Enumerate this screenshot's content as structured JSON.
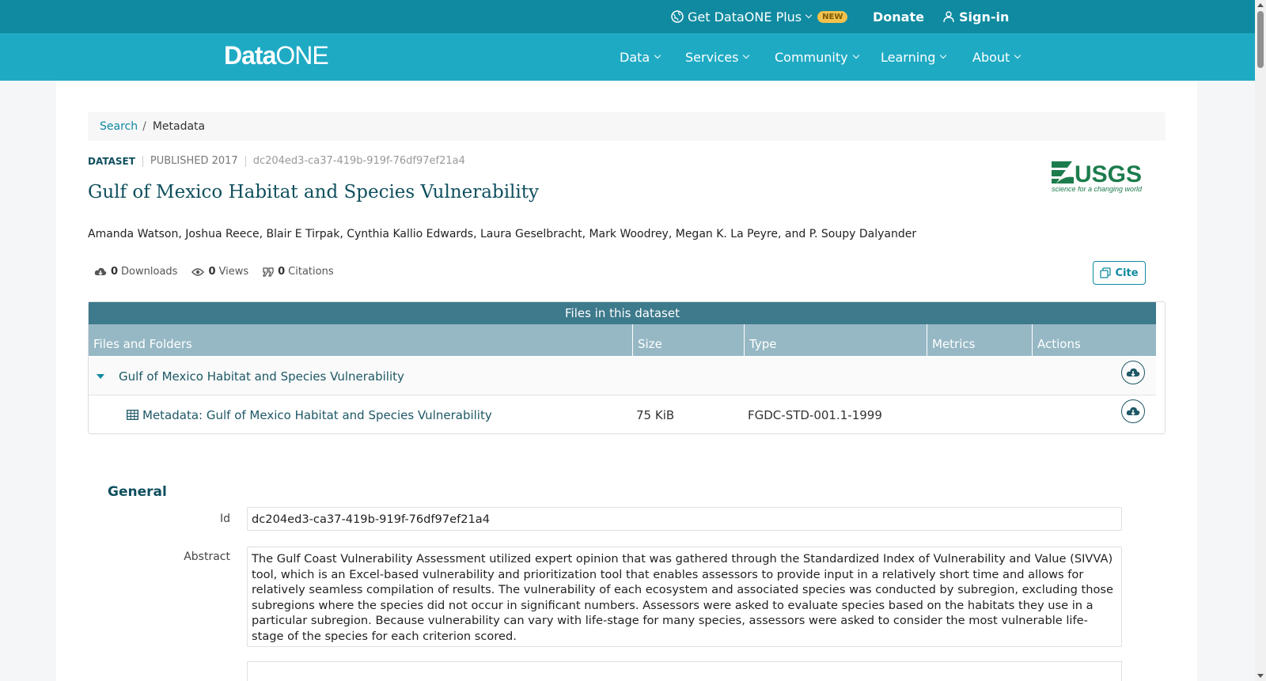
{
  "topbar": {
    "plus_label": "Get DataONE Plus",
    "new_badge": "NEW",
    "donate": "Donate",
    "signin": "Sign-in"
  },
  "nav": {
    "logo_data": "Data",
    "logo_one": "ONE",
    "items": [
      "Data",
      "Services",
      "Community",
      "Learning",
      "About"
    ]
  },
  "breadcrumb": {
    "search": "Search",
    "separator": "/",
    "current": "Metadata"
  },
  "dataset": {
    "type": "DATASET",
    "published": "PUBLISHED 2017",
    "id": "dc204ed3-ca37-419b-919f-76df97ef21a4",
    "title": "Gulf of Mexico Habitat and Species Vulnerability",
    "authors": "Amanda Watson, Joshua Reece, Blair E Tirpak, Cynthia Kallio Edwards, Laura Geselbracht, Mark Woodrey, Megan K. La Peyre, and P. Soupy Dalyander"
  },
  "logo_org": {
    "name": "USGS",
    "tagline": "science for a changing world"
  },
  "stats": {
    "downloads_count": "0",
    "downloads_label": "Downloads",
    "views_count": "0",
    "views_label": "Views",
    "citations_count": "0",
    "citations_label": "Citations"
  },
  "cite_label": "Cite",
  "files": {
    "heading": "Files in this dataset",
    "columns": [
      "Files and Folders",
      "Size",
      "Type",
      "Metrics",
      "Actions"
    ],
    "folder": "Gulf of Mexico Habitat and Species Vulnerability",
    "file_name": "Metadata: Gulf of Mexico Habitat and Species Vulnerability",
    "file_size": "75 KiB",
    "file_type": "FGDC-STD-001.1-1999"
  },
  "general": {
    "heading": "General",
    "id_label": "Id",
    "id_value": "dc204ed3-ca37-419b-919f-76df97ef21a4",
    "abstract_label": "Abstract",
    "abstract_value": "The Gulf Coast Vulnerability Assessment utilized expert opinion that was gathered through the Standardized Index of Vulnerability and Value (SIVVA) tool, which is an Excel-based vulnerability and prioritization tool that enables assessors to provide input in a relatively short time and allows for relatively seamless compilation of results. The vulnerability of each ecosystem and associated species was conducted by subregion, excluding those subregions where the species did not occur in significant numbers. Assessors were asked to evaluate species based on the habitats they use in a particular subregion. Because vulnerability can vary with life-stage for many species, assessors were asked to consider the most vulnerable life-stage of the species for each criterion scored."
  },
  "icons": {
    "globe": "globe-icon",
    "user": "user-icon",
    "cloud": "cloud-download-icon",
    "eye": "eye-icon",
    "quote": "quote-icon",
    "copy": "copy-icon",
    "table": "table-icon"
  },
  "colors": {
    "topbar": "#0f8aa0",
    "navbar": "#1faac4",
    "accent": "#0f4f5e",
    "table_head": "#3d7a8c",
    "col_head": "#96b8c4"
  }
}
